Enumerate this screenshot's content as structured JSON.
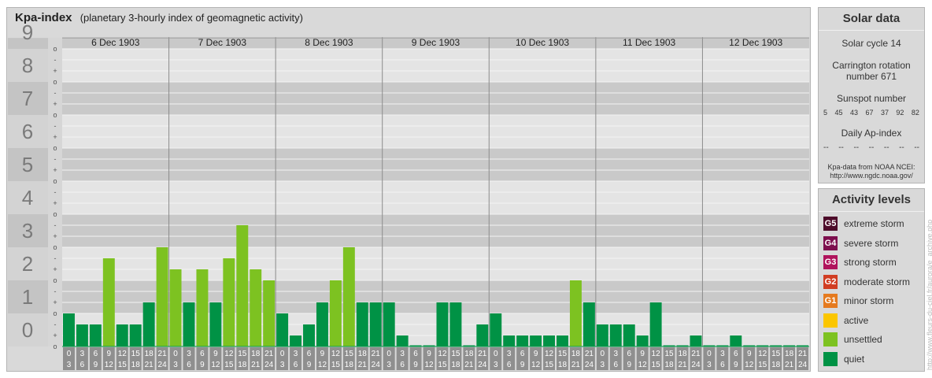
{
  "chart_data": {
    "type": "bar",
    "title": "Kpa-index",
    "subtitle": "(planetary 3-hourly index of geomagnetic activity)",
    "y_ticks": [
      "0",
      "1",
      "2",
      "3",
      "4",
      "5",
      "6",
      "7",
      "8",
      "9"
    ],
    "y_minor_labels": [
      "-",
      "o",
      "+"
    ],
    "ylim": [
      0,
      9.33
    ],
    "days": [
      "6 Dec 1903",
      "7 Dec 1903",
      "8 Dec 1903",
      "9 Dec 1903",
      "10 Dec 1903",
      "11 Dec 1903",
      "12 Dec 1903"
    ],
    "hour_start": [
      "0",
      "3",
      "6",
      "9",
      "12",
      "15",
      "18",
      "21"
    ],
    "hour_end": [
      "3",
      "6",
      "9",
      "12",
      "15",
      "18",
      "21",
      "24"
    ],
    "values": [
      [
        1.0,
        0.667,
        0.667,
        2.667,
        0.667,
        0.667,
        1.333,
        3.0
      ],
      [
        2.333,
        1.333,
        2.333,
        1.333,
        2.667,
        3.667,
        2.333,
        2.0
      ],
      [
        1.0,
        0.333,
        0.667,
        1.333,
        2.0,
        3.0,
        1.333,
        1.333
      ],
      [
        1.333,
        0.333,
        0.0,
        0.0,
        1.333,
        1.333,
        0.0,
        0.667
      ],
      [
        1.0,
        0.333,
        0.333,
        0.333,
        0.333,
        0.333,
        2.0,
        1.333
      ],
      [
        0.667,
        0.667,
        0.667,
        0.333,
        1.333,
        0.0,
        0.0,
        0.333
      ],
      [
        0.0,
        0.0,
        0.333,
        0.0,
        0.0,
        0.0,
        0.0,
        0.0
      ]
    ],
    "colors": {
      "quiet": "#009245",
      "unsettled": "#7dc221",
      "active": "#fbc600",
      "minor": "#e57a1e",
      "moderate": "#d13d22",
      "strong": "#b0135c",
      "severe": "#7d0f4e",
      "extreme": "#4d0c2a"
    }
  },
  "solar": {
    "title": "Solar data",
    "cycle": "Solar cycle 14",
    "carrington_1": "Carrington rotation",
    "carrington_2": "number 671",
    "sunspot_title": "Sunspot number",
    "sunspots": [
      "5",
      "45",
      "43",
      "67",
      "37",
      "92",
      "82"
    ],
    "ap_title": "Daily Ap-index",
    "ap_values": [
      "--",
      "--",
      "--",
      "--",
      "--",
      "--",
      "--"
    ],
    "credit_1": "Kpa-data from NOAA NCEI:",
    "credit_2": "http://www.ngdc.noaa.gov/"
  },
  "activity": {
    "title": "Activity levels",
    "items": [
      {
        "badge": "G5",
        "label": "extreme storm",
        "color": "#4d0c2a"
      },
      {
        "badge": "G4",
        "label": "severe storm",
        "color": "#7d0f4e"
      },
      {
        "badge": "G3",
        "label": "strong storm",
        "color": "#b0135c"
      },
      {
        "badge": "G2",
        "label": "moderate storm",
        "color": "#d13d22"
      },
      {
        "badge": "G1",
        "label": "minor storm",
        "color": "#e57a1e"
      },
      {
        "badge": "",
        "label": "active",
        "color": "#fbc600"
      },
      {
        "badge": "",
        "label": "unsettled",
        "color": "#7dc221"
      },
      {
        "badge": "",
        "label": "quiet",
        "color": "#009245"
      }
    ]
  },
  "watermark": "http://www.fleurs-du-ciel.fr/aurora/e_archive.php"
}
